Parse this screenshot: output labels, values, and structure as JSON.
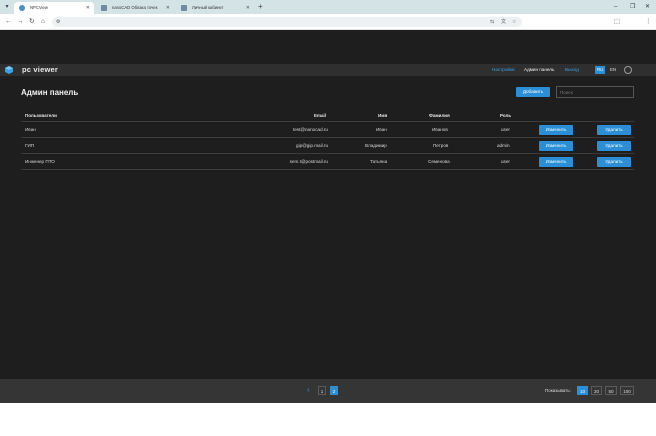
{
  "browser": {
    "tabs": [
      {
        "label": "NPCView",
        "active": true
      },
      {
        "label": "nanoCAD Облака точек",
        "active": false
      },
      {
        "label": "Личный кабинет",
        "active": false
      }
    ],
    "new_tab": "+",
    "window_controls": {
      "minimize": "–",
      "restore": "❐",
      "close": "✕"
    }
  },
  "header": {
    "logo": "pc viewer",
    "nav": {
      "settings": "Настройки",
      "admin": "Админ панель",
      "logout": "Выход"
    },
    "languages": [
      "RU",
      "EN"
    ],
    "active_language": "RU"
  },
  "main": {
    "title": "Админ панель",
    "add_button": "Добавить",
    "search_placeholder": "Поиск",
    "columns": {
      "users": "Пользователи",
      "email": "Email",
      "name": "Имя",
      "surname": "Фамилия",
      "role": "Роль"
    },
    "rows": [
      {
        "user": "Иван",
        "email": "test@nanocad.ru",
        "name": "Иван",
        "surname": "Иванов",
        "role": "user"
      },
      {
        "user": "ГИП",
        "email": "gip@gip.mail.ru",
        "name": "Владимир",
        "surname": "Петров",
        "role": "admin"
      },
      {
        "user": "Инженер ПТО",
        "email": "sem.t@postmail.ru",
        "name": "Татьяна",
        "surname": "Семенова",
        "role": "user"
      }
    ],
    "edit_label": "Изменить",
    "delete_label": "Удалить"
  },
  "footer": {
    "prev": "‹",
    "pages": [
      "1",
      "2"
    ],
    "current_page": "2",
    "show_label": "Показывать:",
    "page_sizes": [
      "10",
      "20",
      "50",
      "100"
    ],
    "current_page_size": "10"
  },
  "colors": {
    "accent": "#2a8fd6",
    "background": "#1e1e1e",
    "header": "#2f2f2f",
    "footer": "#353535"
  }
}
